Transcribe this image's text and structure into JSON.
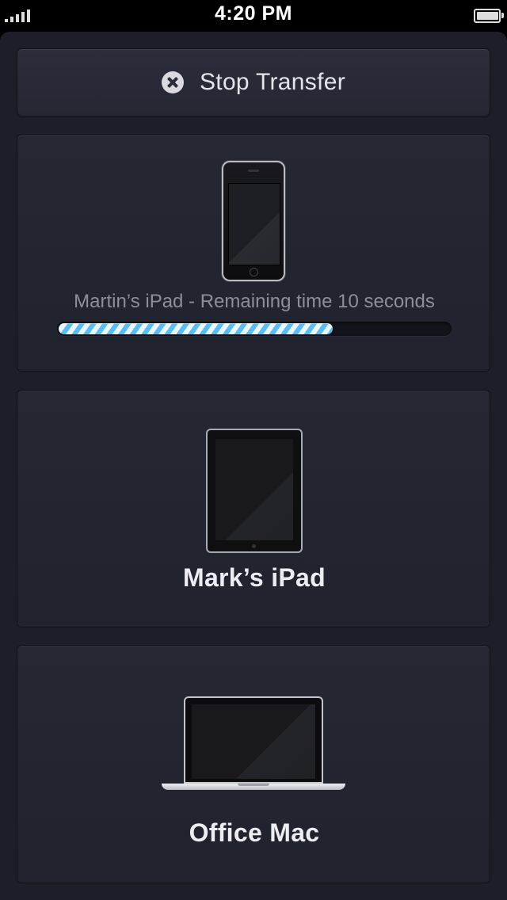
{
  "status_bar": {
    "time": "4:20 PM",
    "signal_icon": "signal-bars-icon",
    "battery_icon": "battery-icon",
    "battery_level": 1.0
  },
  "stop_transfer": {
    "label": "Stop Transfer",
    "icon": "close-circle-icon"
  },
  "transfer": {
    "device_icon": "iphone-icon",
    "status_text": "Martin’s iPad - Remaining time 10 seconds",
    "progress": 0.7
  },
  "devices": [
    {
      "name": "Mark’s iPad",
      "icon": "ipad-icon"
    },
    {
      "name": "Office Mac",
      "icon": "macbook-icon"
    }
  ],
  "colors": {
    "background": "#1d1e28",
    "card": "#232530",
    "progress_accent": "#5bbcf0"
  }
}
